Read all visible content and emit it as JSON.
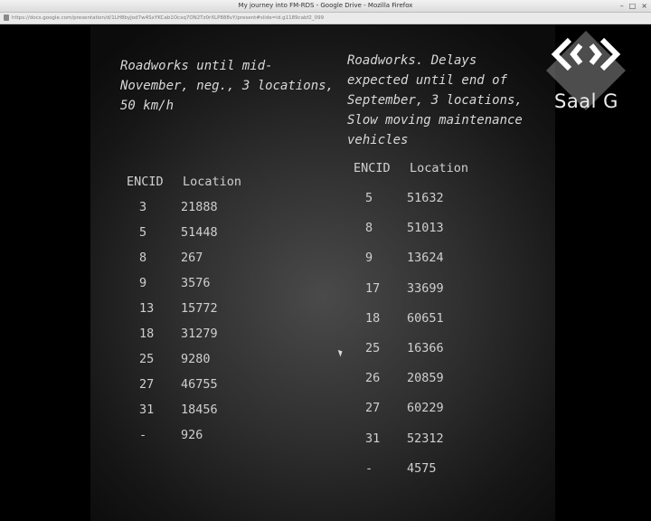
{
  "window": {
    "title": "My journey into FM-RDS - Google Drive - Mozilla Firefox",
    "controls": [
      "–",
      "□",
      "×"
    ]
  },
  "address_bar": {
    "url": "https://docs.google.com/presentation/d/1LH8byJod7w4SxYKCab1Ocxq7ON2Tz0rXLP888vY/present#slide=id.g1189cabf2_099"
  },
  "slide": {
    "left_heading": "Roadworks until mid-\nNovember, neg., 3 locations,\n50 km/h",
    "right_heading": "Roadworks. Delays\nexpected until end of\nSeptember, 3 locations,\nSlow moving maintenance\nvehicles",
    "left_table": {
      "headers": [
        "ENCID",
        "Location"
      ],
      "rows": [
        [
          "3",
          "21888"
        ],
        [
          "5",
          "51448"
        ],
        [
          "8",
          "267"
        ],
        [
          "9",
          "3576"
        ],
        [
          "13",
          "15772"
        ],
        [
          "18",
          "31279"
        ],
        [
          "25",
          "9280"
        ],
        [
          "27",
          "46755"
        ],
        [
          "31",
          "18456"
        ],
        [
          "-",
          "926"
        ]
      ]
    },
    "right_table": {
      "headers": [
        "ENCID",
        "Location"
      ],
      "rows": [
        [
          "5",
          "51632"
        ],
        [
          "8",
          "51013"
        ],
        [
          "9",
          "13624"
        ],
        [
          "17",
          "33699"
        ],
        [
          "18",
          "60651"
        ],
        [
          "25",
          "16366"
        ],
        [
          "26",
          "20859"
        ],
        [
          "27",
          "60229"
        ],
        [
          "31",
          "52312"
        ],
        [
          "-",
          "4575"
        ]
      ]
    },
    "logo": {
      "text": "Saal G",
      "color": "#ffffff"
    }
  }
}
